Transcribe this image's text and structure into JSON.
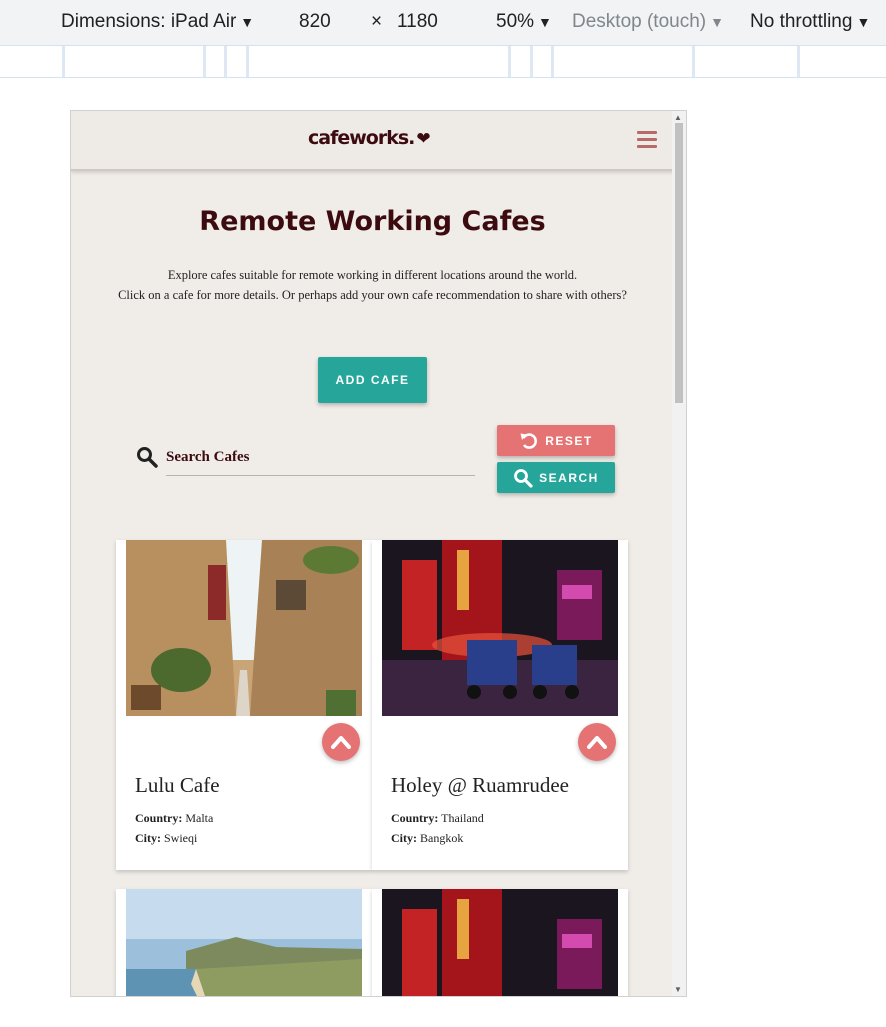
{
  "devtools": {
    "dimensions_label": "Dimensions: iPad Air",
    "width": "820",
    "times": "×",
    "height": "1180",
    "zoom": "50%",
    "mode": "Desktop (touch)",
    "throttling": "No throttling"
  },
  "site": {
    "logo": "cafeworks.",
    "title": "Remote Working Cafes",
    "intro_line1": "Explore cafes suitable for remote working in different locations around the world.",
    "intro_line2": "Click on a cafe for more details. Or perhaps add your own cafe recommendation to share with others?",
    "add_cafe": "ADD CAFE",
    "search_placeholder": "Search Cafes",
    "reset": "RESET",
    "search": "SEARCH"
  },
  "cafes": [
    {
      "name": "Lulu Cafe",
      "country_label": "Country:",
      "country": "Malta",
      "city_label": "City:",
      "city": "Swieqi"
    },
    {
      "name": "Holey @ Ruamrudee",
      "country_label": "Country:",
      "country": "Thailand",
      "city_label": "City:",
      "city": "Bangkok"
    }
  ],
  "colors": {
    "brand": "#3c0b10",
    "teal": "#26a69a",
    "red": "#e57373",
    "background": "#f0ece7"
  }
}
